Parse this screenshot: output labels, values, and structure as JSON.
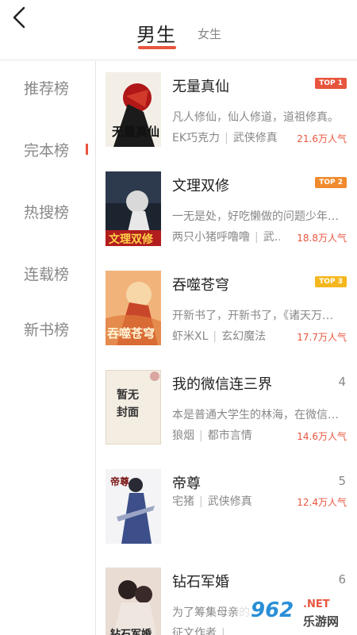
{
  "header": {
    "tabs": [
      {
        "label": "男生",
        "active": true
      },
      {
        "label": "女生",
        "active": false
      }
    ]
  },
  "sidebar": {
    "items": [
      {
        "label": "推荐榜",
        "active": false
      },
      {
        "label": "完本榜",
        "active": true
      },
      {
        "label": "热搜榜",
        "active": false
      },
      {
        "label": "连载榜",
        "active": false
      },
      {
        "label": "新书榜",
        "active": false
      }
    ]
  },
  "books": [
    {
      "title": "无量真仙",
      "rank_badge": "TOP 1",
      "badge_color": "#e8553e",
      "desc": "凡人修仙，仙人修道，道祖修真。",
      "author": "EK巧克力",
      "category": "武侠修真",
      "popularity": "21.6万人气",
      "cover_text": "无量真仙"
    },
    {
      "title": "文理双修",
      "rank_badge": "TOP 2",
      "badge_color": "#f08a2c",
      "desc": "一无是处，好吃懒做的问题少年…",
      "author": "两只小猪呼噜噜",
      "category": "武…",
      "popularity": "18.8万人气",
      "cover_text": "文理双修"
    },
    {
      "title": "吞噬苍穹",
      "rank_badge": "TOP 3",
      "badge_color": "#f5b71e",
      "desc": "开新书了，开新书了，《诸天万…",
      "author": "虾米XL",
      "category": "玄幻魔法",
      "popularity": "17.7万人气",
      "cover_text": "吞噬苍穹"
    },
    {
      "title": "我的微信连三界",
      "rank_number": "4",
      "desc": "本是普通大学生的林海，在微信…",
      "author": "狼烟",
      "category": "都市言情",
      "popularity": "14.6万人气",
      "cover_text": "暂无封面"
    },
    {
      "title": "帝尊",
      "rank_number": "5",
      "author": "宅猪",
      "category": "武侠修真",
      "popularity": "12.4万人气",
      "cover_text": "帝尊"
    },
    {
      "title": "钻石军婚",
      "rank_number": "6",
      "desc": "为了筹集母亲的",
      "author": "征文作者",
      "category": "",
      "popularity": "",
      "cover_text": "钻石军婚"
    }
  ],
  "watermark": {
    "logo_text": "962",
    "net_text": ".NET",
    "site_text": "乐游网"
  },
  "colors": {
    "accent": "#e8553e",
    "text_primary": "#222222",
    "text_secondary": "#888888",
    "divider": "#e6e6e6"
  }
}
